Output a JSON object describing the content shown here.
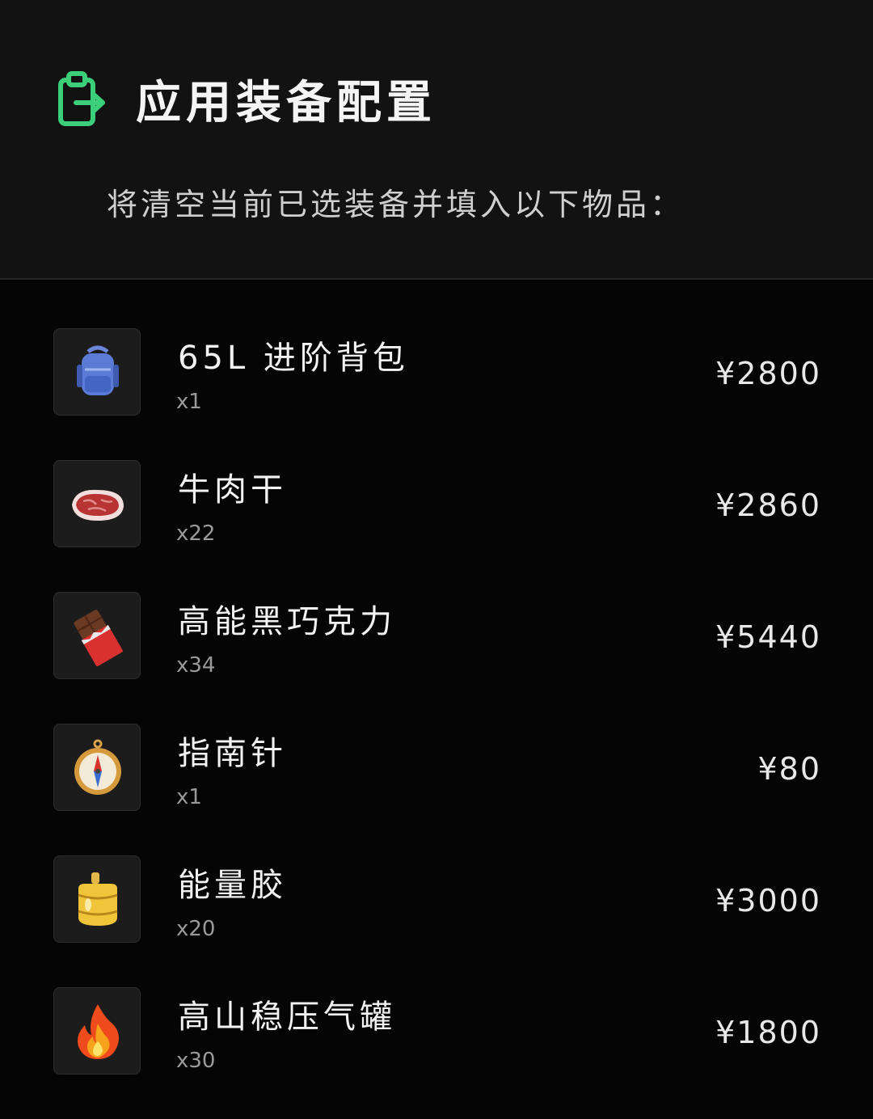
{
  "dialog": {
    "title": "应用装备配置",
    "icon": "clipboard-export-icon",
    "accent_color": "#3ccf7a",
    "subtitle": "将清空当前已选装备并填入以下物品："
  },
  "items": [
    {
      "name": "65L 进阶背包",
      "qty": "x1",
      "price": "¥2800",
      "icon": "backpack-icon"
    },
    {
      "name": "牛肉干",
      "qty": "x22",
      "price": "¥2860",
      "icon": "beef-jerky-icon"
    },
    {
      "name": "高能黑巧克力",
      "qty": "x34",
      "price": "¥5440",
      "icon": "chocolate-bar-icon"
    },
    {
      "name": "指南针",
      "qty": "x1",
      "price": "¥80",
      "icon": "compass-icon"
    },
    {
      "name": "能量胶",
      "qty": "x20",
      "price": "¥3000",
      "icon": "energy-gel-icon"
    },
    {
      "name": "高山稳压气罐",
      "qty": "x30",
      "price": "¥1800",
      "icon": "fire-icon"
    }
  ]
}
